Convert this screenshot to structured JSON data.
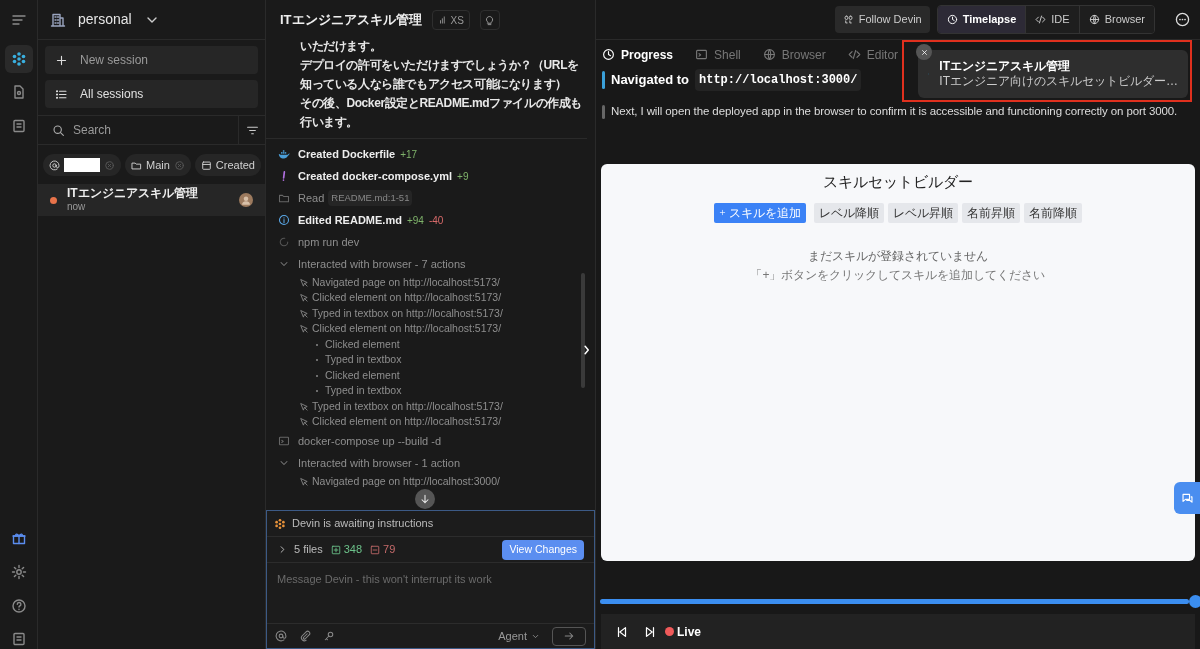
{
  "workspace": {
    "name": "personal"
  },
  "sidebar": {
    "actions": [
      {
        "kind": "new",
        "label": "New session"
      },
      {
        "kind": "list",
        "label": "All sessions"
      }
    ],
    "search": {
      "placeholder": "Search"
    },
    "filters": [
      {
        "kind": "redacted"
      },
      {
        "kind": "branch",
        "label": "Main"
      },
      {
        "kind": "date",
        "label": "Created"
      }
    ],
    "sessions": [
      {
        "title": "ITエンジニアスキル管理",
        "time": "now",
        "selected": true,
        "color": "#e8734a"
      }
    ]
  },
  "session_header": {
    "title": "ITエンジニアスキル管理",
    "size": "XS"
  },
  "message": {
    "lines": [
      "いただけます。",
      "デプロイの許可をいただけますでしょうか？（URLを知っている人なら誰でもアクセス可能になります）",
      "その後、Docker設定とREADME.mdファイルの作成も行います。"
    ]
  },
  "events": [
    {
      "kind": "dockerfile",
      "label": "Created Dockerfile",
      "added": "+17"
    },
    {
      "kind": "yaml",
      "label": "Created docker-compose.yml",
      "added": "+9"
    },
    {
      "kind": "read",
      "label": "Read",
      "ref": "README.md:1-51"
    },
    {
      "kind": "edit",
      "label": "Edited README.md",
      "added": "+94",
      "removed": "-40"
    },
    {
      "kind": "command",
      "label": "npm run dev"
    },
    {
      "kind": "browser",
      "label": "Interacted with browser - 7 actions",
      "expanded": true,
      "children": [
        {
          "label": "Navigated page on http://localhost:5173/"
        },
        {
          "label": "Clicked element on http://localhost:5173/"
        },
        {
          "label": "Typed in textbox on http://localhost:5173/"
        },
        {
          "label": "Clicked element on http://localhost:5173/",
          "children": [
            {
              "label": "Clicked element"
            },
            {
              "label": "Typed in textbox"
            },
            {
              "label": "Clicked element"
            },
            {
              "label": "Typed in textbox"
            }
          ]
        },
        {
          "label": "Typed in textbox on http://localhost:5173/"
        },
        {
          "label": "Clicked element on http://localhost:5173/"
        }
      ]
    },
    {
      "kind": "shell",
      "label": "docker-compose up --build -d"
    },
    {
      "kind": "browser",
      "label": "Interacted with browser - 1 action",
      "expanded": true,
      "children": [
        {
          "label": "Navigated page on http://localhost:3000/"
        }
      ]
    }
  ],
  "composer": {
    "status": "Devin is awaiting instructions",
    "files": "5 files",
    "added": "348",
    "removed": "79",
    "button": "View Changes",
    "placeholder": "Message Devin - this won't interrupt its work",
    "mode": "Agent"
  },
  "toolbar": {
    "follow": "Follow Devin",
    "views": [
      {
        "kind": "timelapse",
        "label": "Timelapse",
        "selected": true
      },
      {
        "kind": "code",
        "label": "IDE",
        "selected": false
      },
      {
        "kind": "globe",
        "label": "Browser",
        "selected": false
      }
    ]
  },
  "panel_tabs": [
    {
      "kind": "clock",
      "label": "Progress",
      "selected": true
    },
    {
      "kind": "terminal",
      "label": "Shell",
      "selected": false
    },
    {
      "kind": "globe",
      "label": "Browser",
      "selected": false
    },
    {
      "kind": "code",
      "label": "Editor",
      "selected": false
    }
  ],
  "steps": [
    {
      "kind": "navigate",
      "label": "Navigated to",
      "url": "http://localhost:3000/"
    },
    {
      "kind": "note",
      "text": "Next, I will open the deployed app in the browser to confirm it is accessible and functioning correctly on port 3000."
    }
  ],
  "notification": {
    "title": "ITエンジニアスキル管理",
    "subtitle": "ITエンジニア向けのスキルセットビルダー…"
  },
  "preview": {
    "title": "スキルセットビルダー",
    "buttons": [
      {
        "kind": "primary",
        "label": "スキルを追加"
      },
      {
        "kind": "plain",
        "label": "レベル降順"
      },
      {
        "kind": "plain",
        "label": "レベル昇順"
      },
      {
        "kind": "plain",
        "label": "名前昇順"
      },
      {
        "kind": "plain",
        "label": "名前降順"
      }
    ],
    "empty": "まだスキルが登録されていません",
    "hint": "「+」ボタンをクリックしてスキルを追加してください"
  },
  "player": {
    "level": 1,
    "live": "Live"
  }
}
